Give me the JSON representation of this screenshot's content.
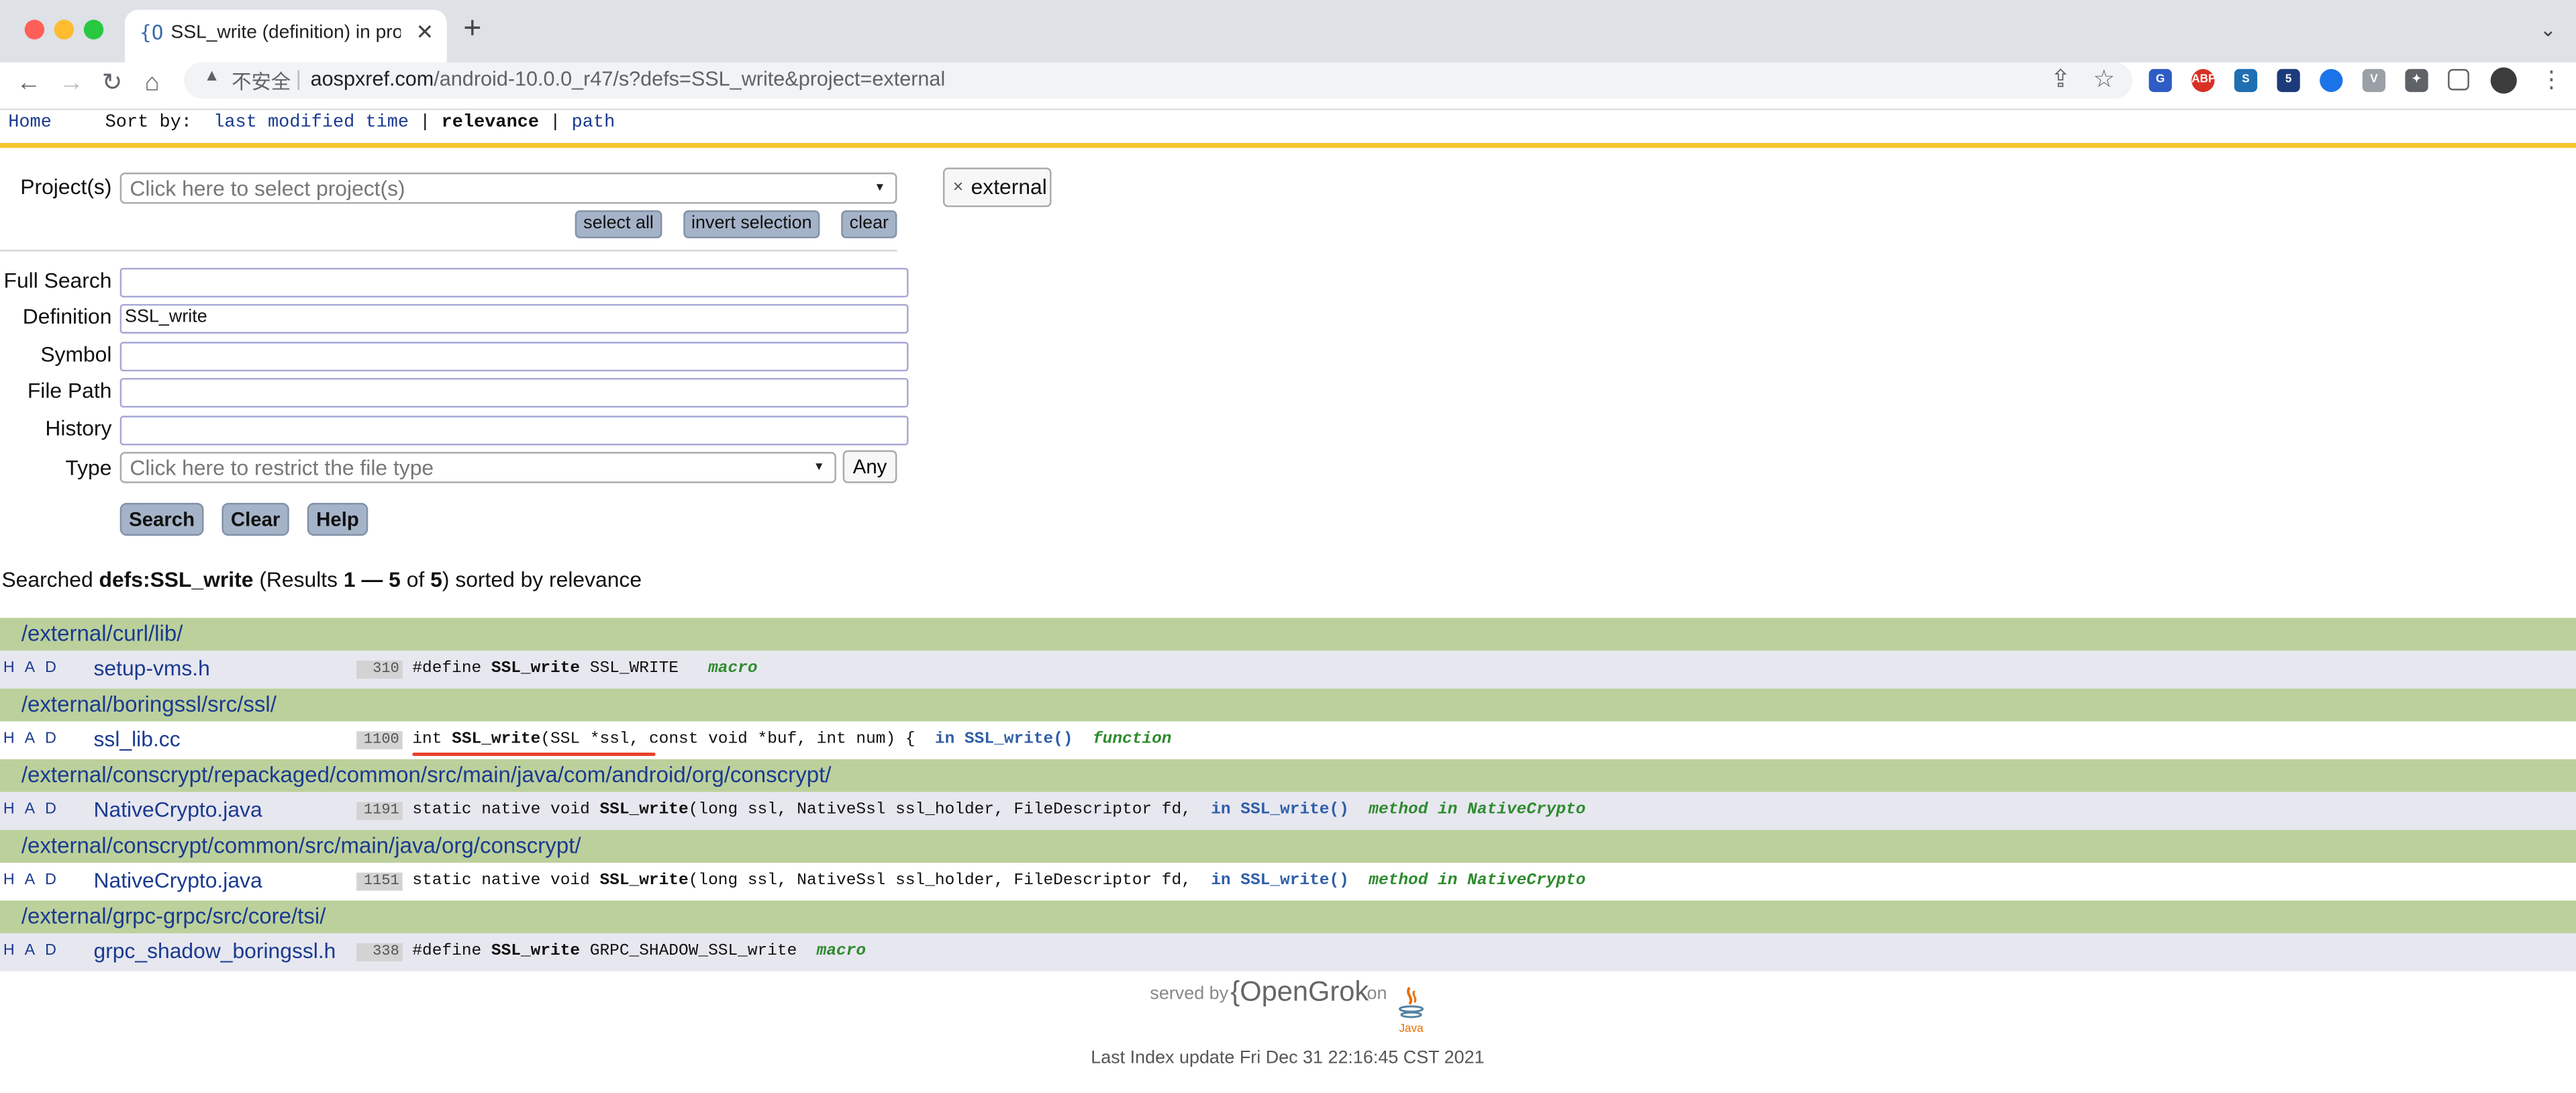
{
  "browser": {
    "tab_title": "SSL_write (definition) in projec",
    "tab_favicon": "{O",
    "insecure_label": "不安全",
    "url_host": "aospxref.com",
    "url_path": "/android-10.0.0_r47/s?defs=SSL_write&project=external",
    "extension_abp_label": "ABP",
    "extension_badge": "5"
  },
  "topnav": {
    "home": "Home",
    "sort_by": "Sort by:",
    "sort_options": [
      "last modified time",
      "relevance",
      "path"
    ],
    "separator": "|"
  },
  "form": {
    "project_label": "Project(s)",
    "project_placeholder": "Click here to select project(s)",
    "select_all": "select all",
    "invert_selection": "invert selection",
    "clear_small": "clear",
    "selected_project": "external",
    "full_search_label": "Full Search",
    "full_search_value": "",
    "definition_label": "Definition",
    "definition_value": "SSL_write",
    "symbol_label": "Symbol",
    "symbol_value": "",
    "file_path_label": "File Path",
    "file_path_value": "",
    "history_label": "History",
    "history_value": "",
    "type_label": "Type",
    "type_placeholder": "Click here to restrict the file type",
    "any_button": "Any",
    "search_button": "Search",
    "clear_button": "Clear",
    "help_button": "Help"
  },
  "summary": {
    "prefix": "Searched",
    "query": "defs:SSL_write",
    "results_open": "(Results",
    "range_start": "1",
    "dash": "—",
    "range_end": "5",
    "of": "of",
    "total": "5",
    "sorted": ") sorted by relevance"
  },
  "results": [
    {
      "dir": "/external/curl/lib/",
      "had": "H A D",
      "file": "setup-vms.h",
      "line": "310",
      "code_pre": "#define ",
      "code_symbol": "SSL_write",
      "code_post": " SSL_WRITE  ",
      "scope": "",
      "kind": "macro"
    },
    {
      "dir": "/external/boringssl/src/ssl/",
      "had": "H A D",
      "file": "ssl_lib.cc",
      "line": "1100",
      "code_pre": "int ",
      "code_symbol": "SSL_write",
      "code_post": "(SSL *ssl, const void *buf, int num) {  ",
      "scope": "in SSL_write()",
      "kind": "function"
    },
    {
      "dir": "/external/conscrypt/repackaged/common/src/main/java/com/android/org/conscrypt/",
      "had": "H A D",
      "file": "NativeCrypto.java",
      "line": "1191",
      "code_pre": "static native void ",
      "code_symbol": "SSL_write",
      "code_post": "(long ssl, NativeSsl ssl_holder, FileDescriptor fd,  ",
      "scope": "in SSL_write()",
      "kind": "method in NativeCrypto"
    },
    {
      "dir": "/external/conscrypt/common/src/main/java/org/conscrypt/",
      "had": "H A D",
      "file": "NativeCrypto.java",
      "line": "1151",
      "code_pre": "static native void ",
      "code_symbol": "SSL_write",
      "code_post": "(long ssl, NativeSsl ssl_holder, FileDescriptor fd,  ",
      "scope": "in SSL_write()",
      "kind": "method in NativeCrypto"
    },
    {
      "dir": "/external/grpc-grpc/src/core/tsi/",
      "had": "H A D",
      "file": "grpc_shadow_boringssl.h",
      "line": "338",
      "code_pre": "#define ",
      "code_symbol": "SSL_write",
      "code_post": " GRPC_SHADOW_SSL_write  ",
      "scope": "",
      "kind": "macro"
    }
  ],
  "footer": {
    "served_by": "served by",
    "brand": "{OpenGrok",
    "on": "on",
    "java_label": "Java",
    "last_index": "Last Index update Fri Dec 31 22:16:45 CST 2021"
  },
  "colors": {
    "link": "#1a3a8f",
    "dir_row": "#bcd09c",
    "alt_row": "#e7e7f0",
    "accent_bar": "#f7c52b",
    "button": "#a5b3c9"
  }
}
